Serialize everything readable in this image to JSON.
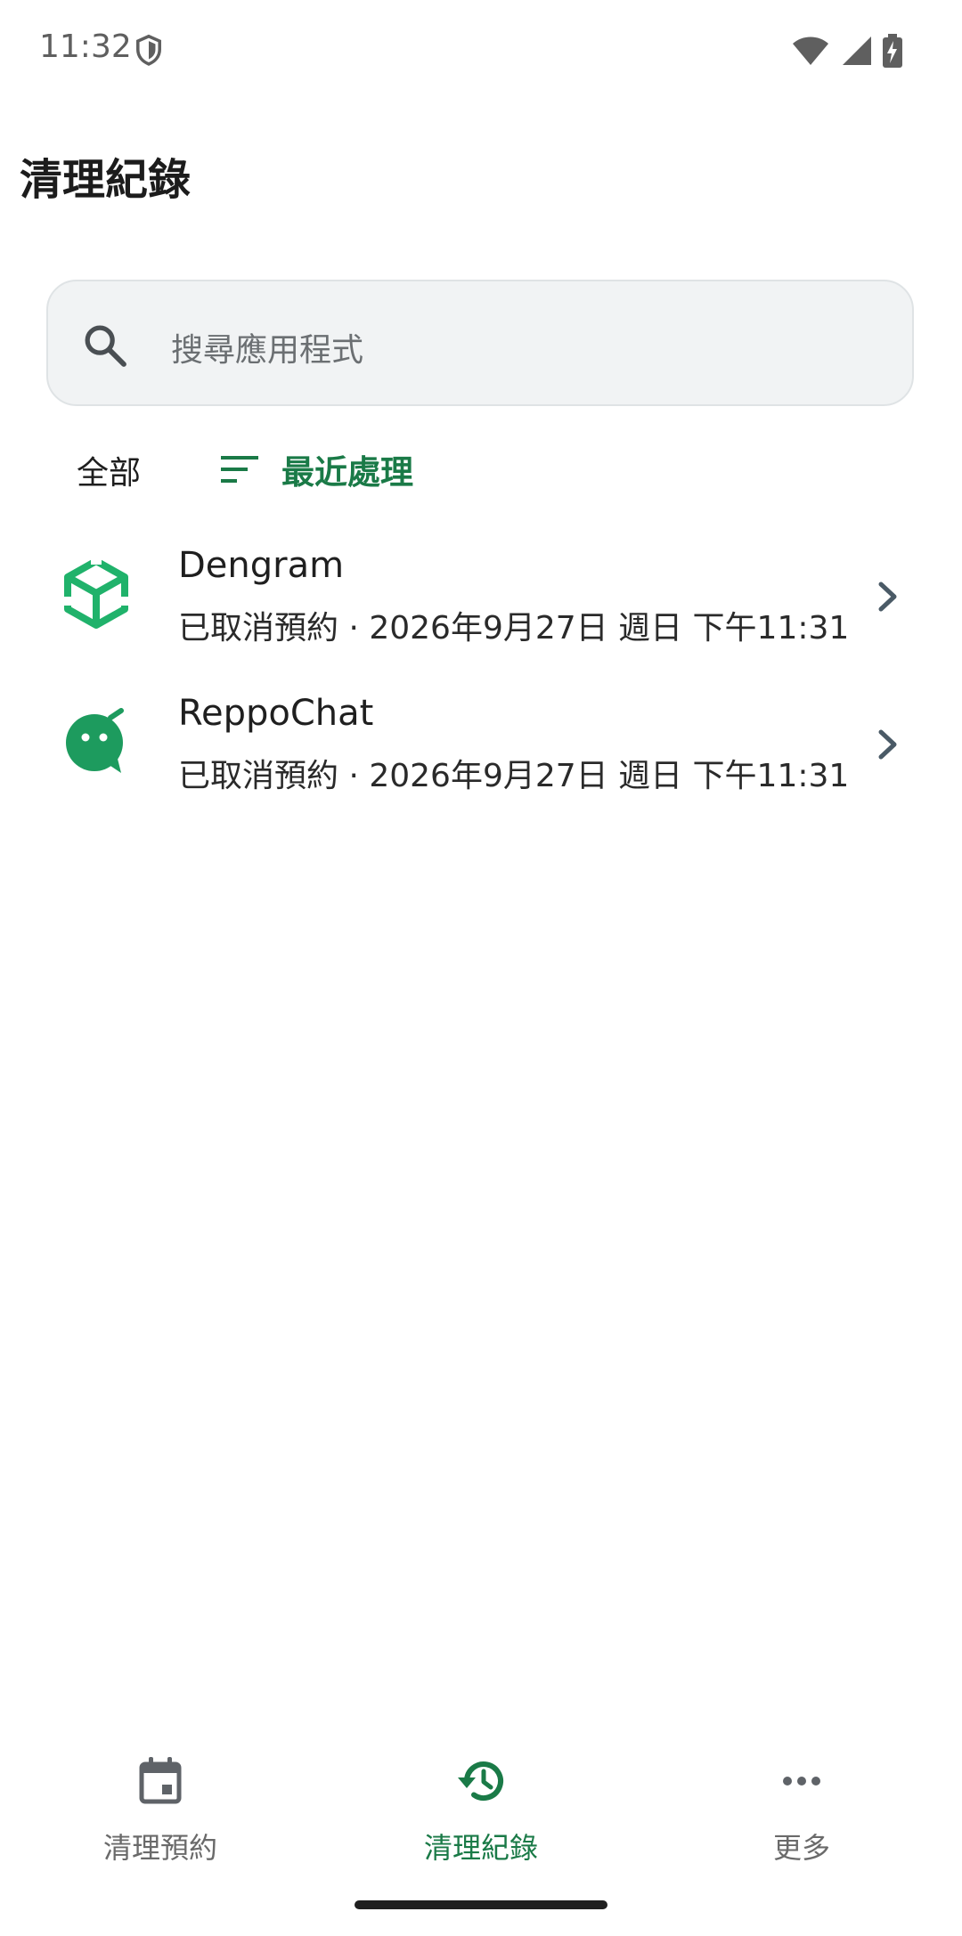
{
  "status_bar": {
    "time": "11:32"
  },
  "page": {
    "title": "清理紀錄"
  },
  "search": {
    "placeholder": "搜尋應用程式"
  },
  "filters": {
    "all_label": "全部",
    "sort_label": "最近處理"
  },
  "records": [
    {
      "app_name": "Dengram",
      "detail": "已取消預約 · 2026年9月27日 週日 下午11:31",
      "icon": "dengram-cube-icon"
    },
    {
      "app_name": "ReppoChat",
      "detail": "已取消預約 · 2026年9月27日 週日 下午11:31",
      "icon": "reppochat-bubble-icon"
    }
  ],
  "bottom_nav": {
    "items": [
      {
        "label": "清理預約",
        "icon": "calendar-icon",
        "active": false
      },
      {
        "label": "清理紀錄",
        "icon": "history-icon",
        "active": true
      },
      {
        "label": "更多",
        "icon": "more-horizontal-icon",
        "active": false
      }
    ]
  },
  "colors": {
    "accent": "#1a7a47",
    "icon_green": "#20b26b",
    "search_bg": "#f1f3f4"
  }
}
